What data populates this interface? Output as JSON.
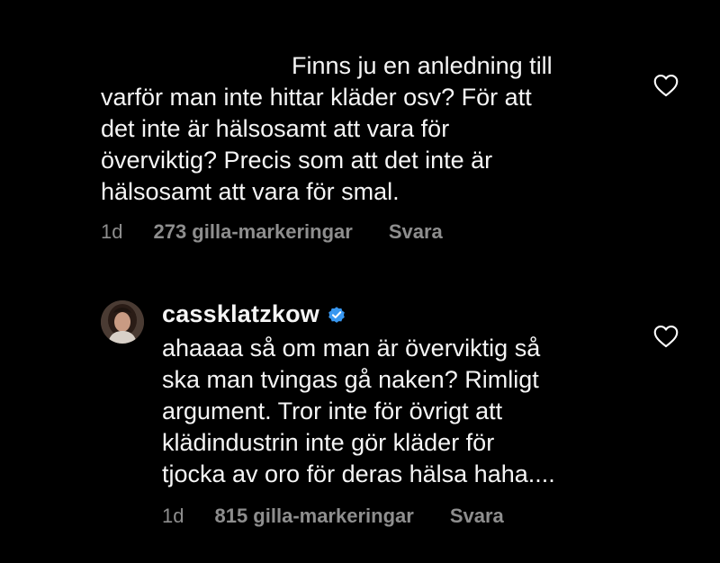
{
  "comment1": {
    "text": "Finns ju en anledning till\nvarför man inte hittar kläder osv? För att\ndet inte är hälsosamt att vara för\növerviktig? Precis som att det inte är\nhälsosamt att vara för smal.",
    "time": "1d",
    "likes": "273 gilla-markeringar",
    "reply": "Svara",
    "like_icon": "heart-outline-icon"
  },
  "comment2": {
    "username": "cassklatzkow",
    "verified_icon": "verified-badge-icon",
    "text": "ahaaaa så om man är överviktig så\nska man tvingas gå naken? Rimligt\nargument. Tror inte för övrigt att\nklädindustrin inte gör kläder för\ntjocka av oro för deras hälsa haha....",
    "time": "1d",
    "likes": "815 gilla-markeringar",
    "reply": "Svara",
    "like_icon": "heart-outline-icon"
  },
  "colors": {
    "background": "#000000",
    "text": "#f5f5f5",
    "muted": "#8e8e8e",
    "verified": "#3897f0"
  }
}
